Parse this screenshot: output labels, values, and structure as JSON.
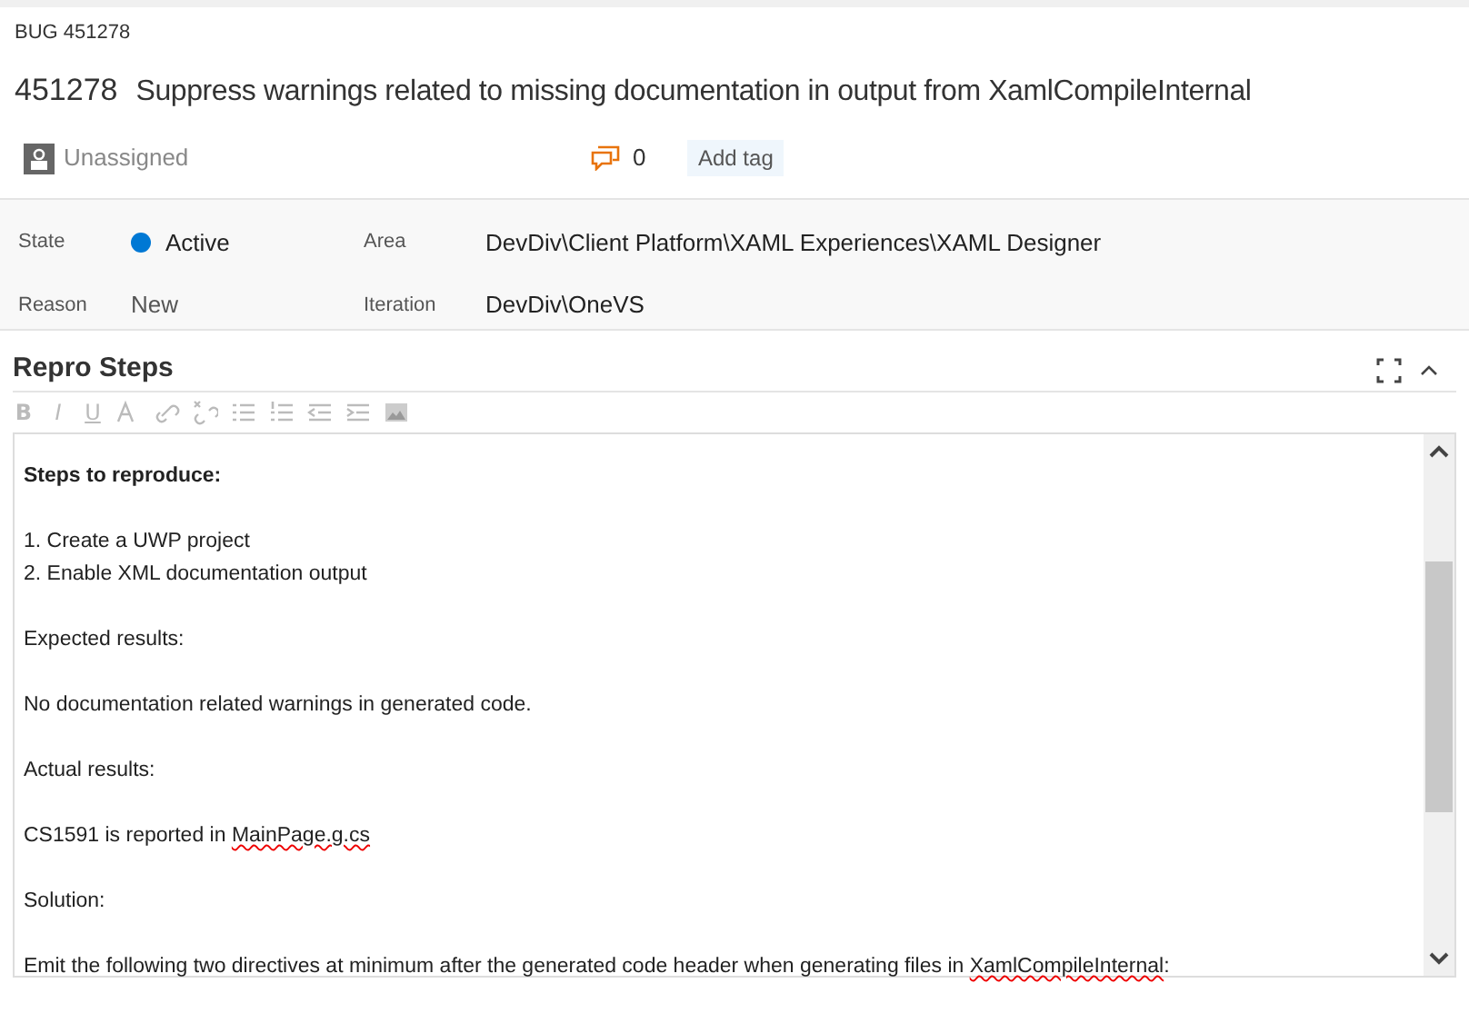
{
  "work_item": {
    "type_label": "BUG 451278",
    "id": "451278",
    "title": "Suppress warnings related to missing documentation in output from XamlCompileInternal"
  },
  "meta": {
    "assignee": "Unassigned",
    "comment_count": "0",
    "add_tag": "Add tag"
  },
  "fields": [
    {
      "label": "State",
      "value": "Active",
      "kind": "state",
      "color": "#0078d4"
    },
    {
      "label": "Area",
      "value": "DevDiv\\Client Platform\\XAML Experiences\\XAML Designer",
      "kind": "plain"
    },
    {
      "label": "Reason",
      "value": "New",
      "kind": "plain"
    },
    {
      "label": "Iteration",
      "value": "DevDiv\\OneVS",
      "kind": "plain"
    }
  ],
  "section": {
    "title": "Repro Steps",
    "toolbar_letters": [
      "B",
      "I",
      "U"
    ]
  },
  "body": [
    [
      {
        "bold": true,
        "segments": [
          {
            "text": "Steps to reproduce:",
            "misspelled": false
          }
        ]
      }
    ],
    [
      {
        "bold": false,
        "segments": [
          {
            "text": "1. Create a UWP project",
            "misspelled": false
          }
        ]
      },
      {
        "bold": false,
        "segments": [
          {
            "text": "2. Enable XML documentation output",
            "misspelled": false
          }
        ]
      }
    ],
    [
      {
        "bold": false,
        "segments": [
          {
            "text": "Expected results:",
            "misspelled": false
          }
        ]
      }
    ],
    [
      {
        "bold": false,
        "segments": [
          {
            "text": "No documentation related warnings in generated code.",
            "misspelled": false
          }
        ]
      }
    ],
    [
      {
        "bold": false,
        "segments": [
          {
            "text": "Actual results:",
            "misspelled": false
          }
        ]
      }
    ],
    [
      {
        "bold": false,
        "segments": [
          {
            "text": "CS1591 is reported in ",
            "misspelled": false
          },
          {
            "text": "MainPage.g.cs",
            "misspelled": true
          }
        ]
      }
    ],
    [
      {
        "bold": false,
        "segments": [
          {
            "text": "Solution:",
            "misspelled": false
          }
        ]
      }
    ],
    [
      {
        "bold": false,
        "segments": [
          {
            "text": "Emit the following two directives at minimum after the generated code header when generating files in ",
            "misspelled": false
          },
          {
            "text": "XamlCompileInternal",
            "misspelled": true
          },
          {
            "text": ":",
            "misspelled": false
          }
        ]
      }
    ]
  ]
}
